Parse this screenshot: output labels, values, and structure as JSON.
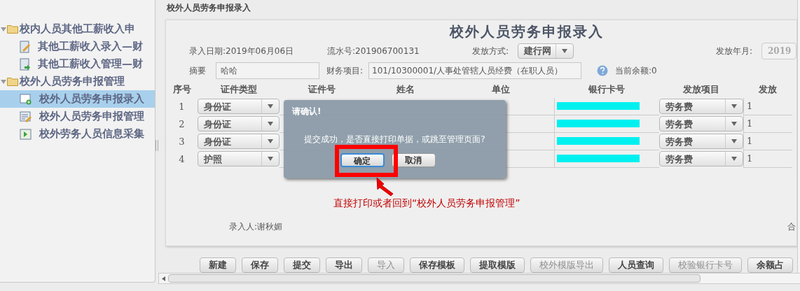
{
  "sidebar": {
    "groups": [
      {
        "label": "校内人员其他工薪收入申",
        "expanded": true,
        "children": [
          {
            "label": "其他工薪收入录入—财",
            "kind": "edit",
            "selected": false
          },
          {
            "label": "其他工薪收入管理—财",
            "kind": "manage",
            "selected": false
          }
        ]
      },
      {
        "label": "校外人员劳务申报管理",
        "expanded": true,
        "children": [
          {
            "label": "校外人员劳务申报录入",
            "kind": "add",
            "selected": true
          },
          {
            "label": "校外人员劳务申报管理",
            "kind": "list",
            "selected": false
          },
          {
            "label": "校外劳务人员信息采集",
            "kind": "import",
            "selected": false
          }
        ]
      }
    ]
  },
  "page_title": "校外人员劳务申报录入",
  "form": {
    "title": "校外人员劳务申报录入",
    "entry_date": "录入日期:2019年06月06日",
    "serial": "流水号:201906700131",
    "pay_method_label": "发放方式:",
    "pay_method": "建行网",
    "pay_month_label": "发放年月:",
    "pay_month": "2019",
    "summary_label": "摘要",
    "summary": "哈哈",
    "finance_label": "财务项目:",
    "finance": "101/10300001/人事处管辖人员经费（在职人员）",
    "balance": "当前余额:0",
    "entered_by": "录入人:谢秋媚",
    "column_9": "合"
  },
  "table": {
    "columns": [
      "序号",
      "证件类型",
      "证件号",
      "姓名",
      "单位",
      "银行卡号",
      "发放项目",
      "发放"
    ],
    "rows": [
      {
        "no": "1",
        "id_type": "身份证",
        "item": "劳务费",
        "amount": "1"
      },
      {
        "no": "2",
        "id_type": "身份证",
        "item": "劳务费",
        "amount": "1"
      },
      {
        "no": "3",
        "id_type": "身份证",
        "item": "劳务费",
        "amount": "1"
      },
      {
        "no": "4",
        "id_type": "护照",
        "item": "劳务费",
        "amount": "1"
      }
    ]
  },
  "dialog": {
    "title": "请确认!",
    "message": "提交成功，是否直接打印单据，或跳至管理页面?",
    "buttons": [
      {
        "label": "确定",
        "focused": true
      },
      {
        "label": "取消",
        "focused": false
      }
    ]
  },
  "annotation": "直接打印或者回到“校外人员劳务申报管理”",
  "toolbar": [
    {
      "label": "新建",
      "disabled": false
    },
    {
      "label": "保存",
      "disabled": false
    },
    {
      "label": "提交",
      "disabled": false
    },
    {
      "label": "导出",
      "disabled": false
    },
    {
      "label": "导入",
      "disabled": true
    },
    {
      "label": "保存模板",
      "disabled": false
    },
    {
      "label": "提取模版",
      "disabled": false
    },
    {
      "label": "校外模版导出",
      "disabled": true
    },
    {
      "label": "人员查询",
      "disabled": false
    },
    {
      "label": "校验银行卡号",
      "disabled": true
    },
    {
      "label": "余额占",
      "disabled": false
    }
  ]
}
